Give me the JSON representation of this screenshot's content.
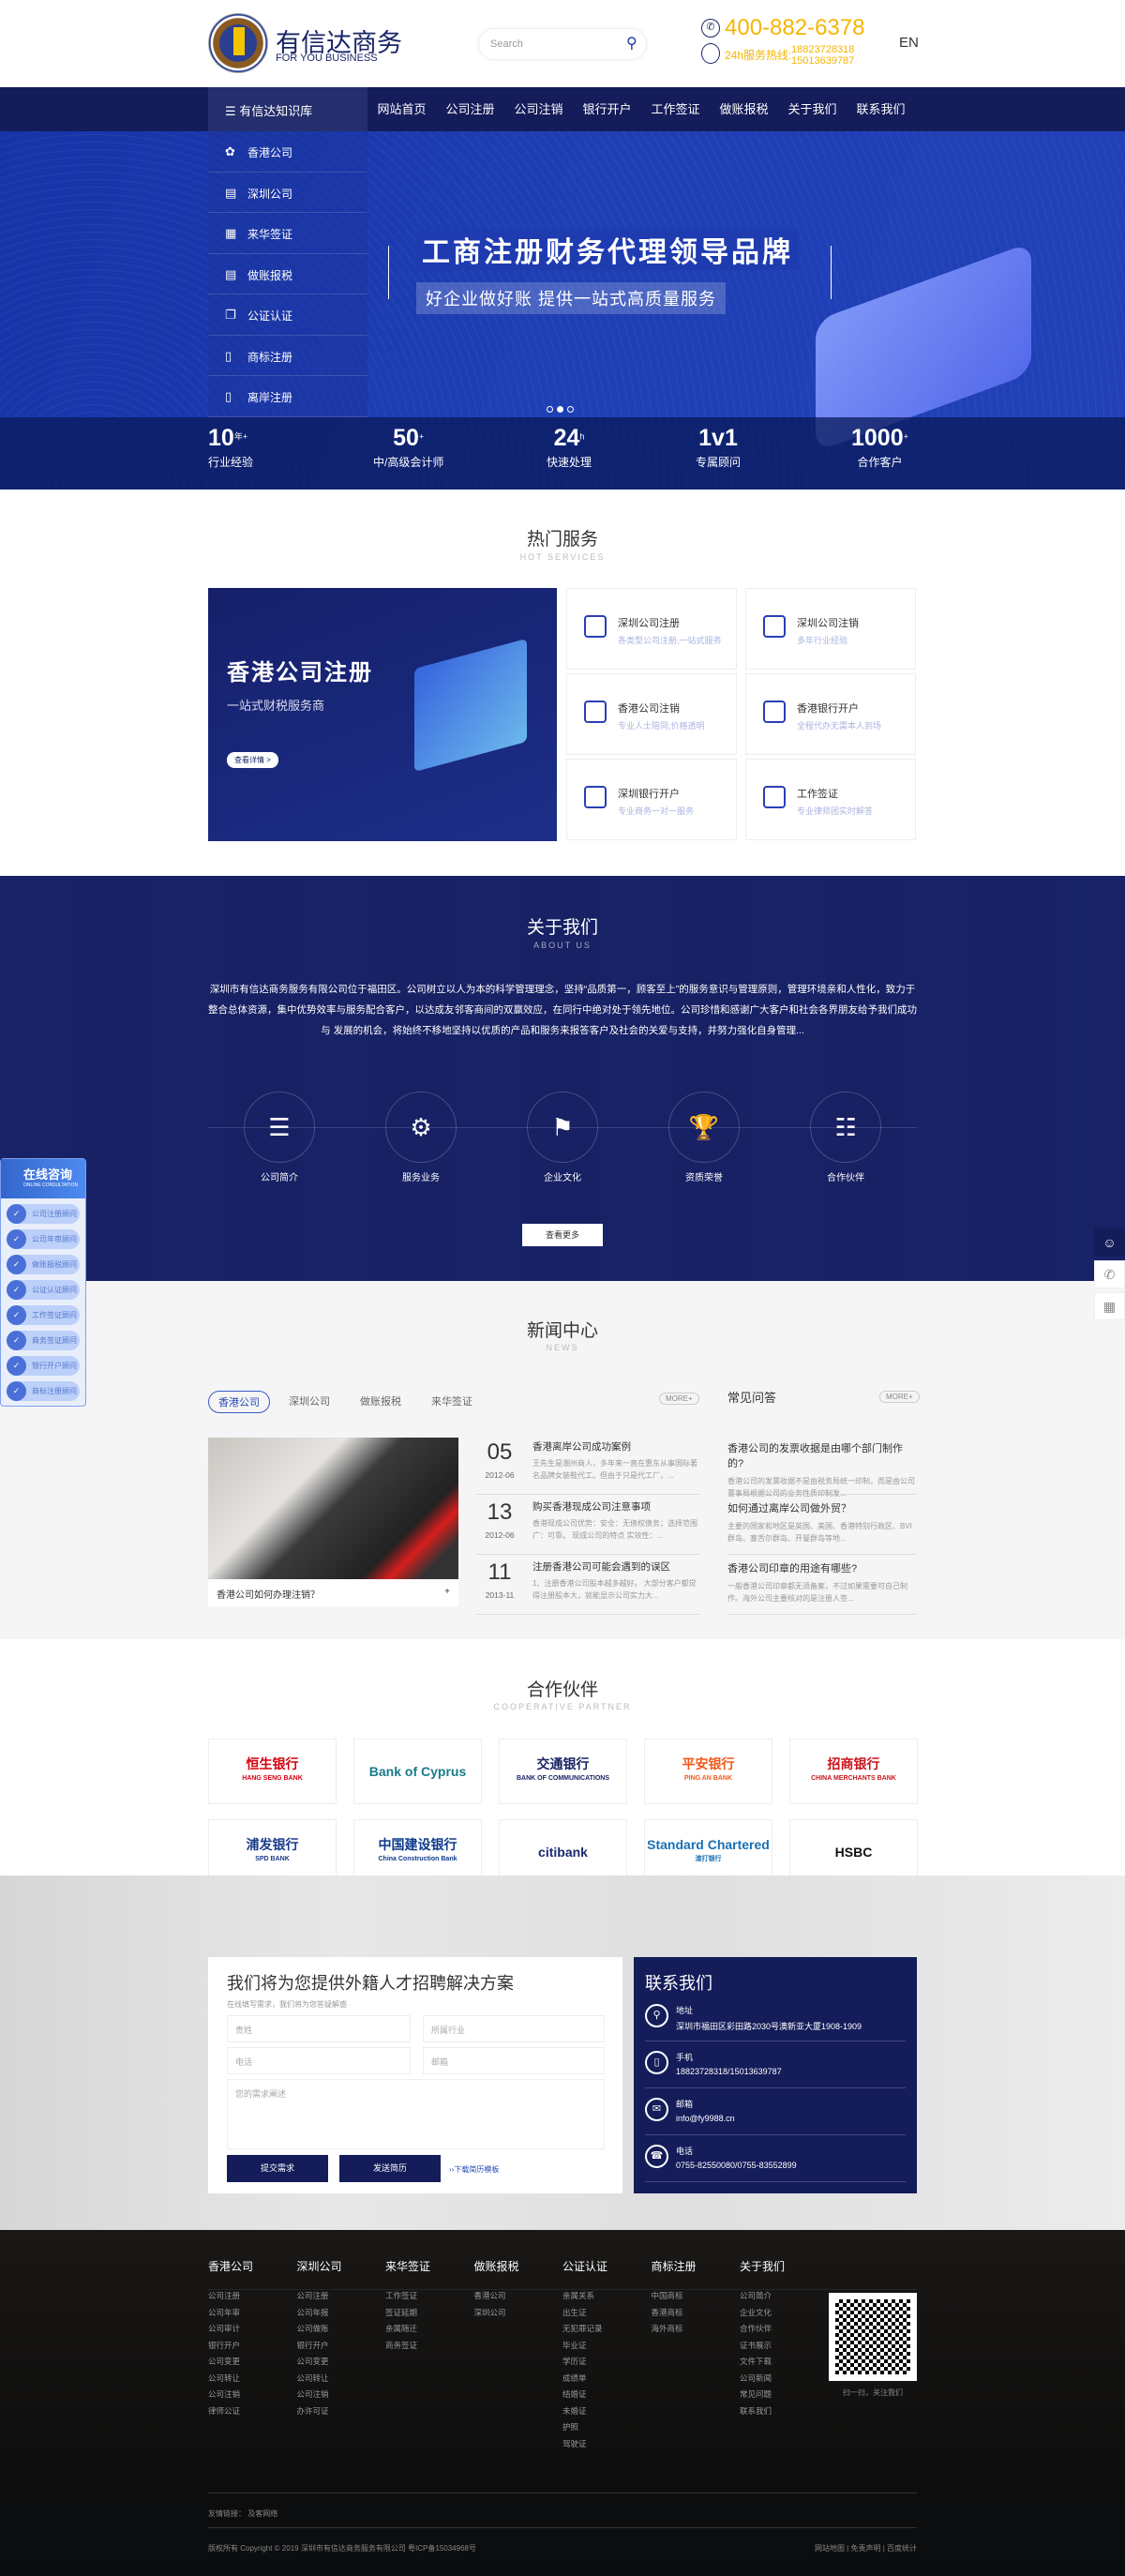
{
  "header": {
    "brand": "有信达商务",
    "brand_en": "FOR YOU BUSINESS",
    "search_placeholder": "Search",
    "phone": "400-882-6378",
    "hotline_label": "24h服务热线:",
    "hotline_1": "18823728318",
    "hotline_2": "15013639787",
    "lang": "EN"
  },
  "nav": {
    "kb": "有信达知识库",
    "items": [
      "网站首页",
      "公司注册",
      "公司注销",
      "银行开户",
      "工作签证",
      "做账报税",
      "关于我们",
      "联系我们"
    ]
  },
  "side_menu": [
    {
      "label": "香港公司",
      "icon": "bauhinia-icon"
    },
    {
      "label": "深圳公司",
      "icon": "bar-chart-icon"
    },
    {
      "label": "来华签证",
      "icon": "calendar-icon"
    },
    {
      "label": "做账报税",
      "icon": "document-icon"
    },
    {
      "label": "公证认证",
      "icon": "copy-icon"
    },
    {
      "label": "商标注册",
      "icon": "book-icon"
    },
    {
      "label": "离岸注册",
      "icon": "book-icon"
    }
  ],
  "banner": {
    "title": "工商注册财务代理领导品牌",
    "subtitle": "好企业做好账 提供一站式高质量服务",
    "slides": 3,
    "active_slide": 2
  },
  "stats": [
    {
      "num": "10",
      "sup": "年+",
      "label": "行业经验"
    },
    {
      "num": "50",
      "sup": "+",
      "label": "中/高级会计师"
    },
    {
      "num": "24",
      "sup": "h",
      "label": "快速处理"
    },
    {
      "num": "1v1",
      "sup": "",
      "label": "专属顾问"
    },
    {
      "num": "1000",
      "sup": "+",
      "label": "合作客户"
    }
  ],
  "hot": {
    "title": "热门服务",
    "subtitle": "HOT SERVICES",
    "card_title": "香港公司注册",
    "card_sub": "一站式财税服务商",
    "card_btn": "查看详情 >",
    "items": [
      {
        "t": "深圳公司注册",
        "d": "各类型公司注册,一站式服务"
      },
      {
        "t": "深圳公司注销",
        "d": "多年行业经验"
      },
      {
        "t": "香港公司注销",
        "d": "专业人士陪同,价格透明"
      },
      {
        "t": "香港银行开户",
        "d": "全程代办无需本人到场"
      },
      {
        "t": "深圳银行开户",
        "d": "专业商务一对一服务"
      },
      {
        "t": "工作签证",
        "d": "专业律师团实时解答"
      }
    ]
  },
  "about": {
    "title": "关于我们",
    "subtitle": "ABOUT US",
    "text": "深圳市有信达商务服务有限公司位于福田区。公司树立以人为本的科学管理理念，坚持“品质第一，顾客至上”的服务意识与管理原则，管理环境亲和人性化，致力于 整合总体资源，集中优势效率与服务配合客户，以达成友邻客商间的双赢效应，在同行中绝对处于领先地位。公司珍惜和感谢广大客户和社会各界朋友给予我们成功与 发展的机会，将始终不移地坚持以优质的产品和服务来报答客户及社会的关爱与支持，并努力强化自身管理...",
    "items": [
      {
        "label": "公司简介",
        "icon": "list-icon"
      },
      {
        "label": "服务业务",
        "icon": "robot-arm-icon"
      },
      {
        "label": "企业文化",
        "icon": "bookmark-icon"
      },
      {
        "label": "资质荣誉",
        "icon": "trophy-icon"
      },
      {
        "label": "合作伙伴",
        "icon": "sitemap-icon"
      }
    ],
    "more": "查看更多"
  },
  "news": {
    "title": "新闻中心",
    "subtitle": "NEWS",
    "tabs": [
      "香港公司",
      "深圳公司",
      "做账报税",
      "来华签证"
    ],
    "more": "MORE+",
    "featured": "香港公司如何办理注销？",
    "items": [
      {
        "day": "05",
        "ym": "2012-06",
        "title": "香港离岸公司成功案例",
        "desc": "王先生是潮州商人，多年来一直在惠东从事国际著名品牌女装鞋代工。但由于只是代工厂，..."
      },
      {
        "day": "13",
        "ym": "2012-06",
        "title": "购买香港现成公司注意事项",
        "desc": "香港现成公司优势：安全：无债权债务；选择范围广：可靠。 现成公司的特点 实效性：..."
      },
      {
        "day": "11",
        "ym": "2013-11",
        "title": "注册香港公司可能会遇到的误区",
        "desc": "1、注册香港公司股本越多越好。 大部分客户都觉得注册股本大，就能显示公司实力大..."
      }
    ],
    "faq_title": "常见问答",
    "faq": [
      {
        "q": "香港公司的发票收据是由哪个部门制作的?",
        "a": "香港公司的发票收据不是由税务局统一印制，而是由公司董事局根据公司的业务性质印制发..."
      },
      {
        "q": "如何通过离岸公司做外贸？",
        "a": "主要的国家和地区是英国、美国、香港特别行政区、BVI群岛、塞舌尔群岛、开曼群岛等地..."
      },
      {
        "q": "香港公司印章的用途有哪些?",
        "a": "一般香港公司印章都无须备案，不过如果需要可自己制作。海外公司主要核对的是注册人签..."
      }
    ]
  },
  "partners": {
    "title": "合作伙伴",
    "subtitle": "COOPERATIVE PARTNER",
    "logos": [
      {
        "name": "恒生银行",
        "en": "HANG SENG BANK",
        "color": "#d7000f"
      },
      {
        "name": "Bank of Cyprus",
        "en": "",
        "color": "#1a7a8a"
      },
      {
        "name": "交通银行",
        "en": "BANK OF COMMUNICATIONS",
        "color": "#1a2466"
      },
      {
        "name": "平安银行",
        "en": "PING AN BANK",
        "color": "#f05a1a"
      },
      {
        "name": "招商银行",
        "en": "CHINA MERCHANTS BANK",
        "color": "#c8161d"
      },
      {
        "name": "浦发银行",
        "en": "SPD BANK",
        "color": "#1a3a8a"
      },
      {
        "name": "中国建设银行",
        "en": "China Construction Bank",
        "color": "#0d3a8a"
      },
      {
        "name": "citibank",
        "en": "",
        "color": "#1a2a70"
      },
      {
        "name": "Standard Chartered",
        "en": "渣打银行",
        "color": "#1a70b5"
      },
      {
        "name": "HSBC",
        "en": "",
        "color": "#111"
      }
    ]
  },
  "contact_form": {
    "title": "我们将为您提供外籍人才招聘解决方案",
    "sub": "在线填写需求，我们将为您答疑解惑",
    "name": "贵姓",
    "industry": "所属行业",
    "phone": "电话",
    "email": "邮箱",
    "desc": "您的需求阐述",
    "submit": "提交需求",
    "resume": "发送简历",
    "download": "››下载简历模板"
  },
  "contact": {
    "title": "联系我们",
    "rows": [
      {
        "label": "地址",
        "value": "深圳市福田区彩田路2030号澳新亚大厦1908-1909",
        "icon": "location-icon"
      },
      {
        "label": "手机",
        "value": "18823728318/15013639787",
        "icon": "mobile-icon"
      },
      {
        "label": "邮箱",
        "value": "info@fy9988.cn",
        "icon": "mail-icon"
      },
      {
        "label": "电话",
        "value": "0755-82550080/0755-83552899",
        "icon": "telephone-icon"
      }
    ]
  },
  "footer": {
    "cols": [
      {
        "h": "香港公司",
        "items": [
          "公司注册",
          "公司年审",
          "公司审计",
          "银行开户",
          "公司变更",
          "公司转让",
          "公司注销",
          "律师公证"
        ]
      },
      {
        "h": "深圳公司",
        "items": [
          "公司注册",
          "公司年报",
          "公司做账",
          "银行开户",
          "公司变更",
          "公司转让",
          "公司注销",
          "办许可证"
        ]
      },
      {
        "h": "来华签证",
        "items": [
          "工作签证",
          "签证延期",
          "亲属随迁",
          "商务签证"
        ]
      },
      {
        "h": "做账报税",
        "items": [
          "香港公司",
          "深圳公司"
        ]
      },
      {
        "h": "公证认证",
        "items": [
          "亲属关系",
          "出生证",
          "无犯罪记录",
          "毕业证",
          "学历证",
          "成绩单",
          "结婚证",
          "未婚证",
          "护照",
          "驾驶证"
        ]
      },
      {
        "h": "商标注册",
        "items": [
          "中国商标",
          "香港商标",
          "海外商标"
        ]
      },
      {
        "h": "关于我们",
        "items": [
          "公司简介",
          "企业文化",
          "合作伙伴",
          "证书展示",
          "文件下载",
          "公司新闻",
          "常见问题",
          "联系我们"
        ]
      }
    ],
    "qr_text": "扫一扫，关注我们",
    "friend_links": "友情链接：  及客网络",
    "copyright": "版权所有 Copyright © 2019 深圳市有信达商务服务有限公司   粤ICP备15034968号",
    "links": "网站地图 | 免责声明 | 百度统计"
  },
  "float_left": {
    "title": "在线咨询",
    "title_en": "ONLINE CONSULTATION",
    "items": [
      "公司注册顾问",
      "公司年审顾问",
      "做账报税顾问",
      "公证认证顾问",
      "工作签证顾问",
      "商务签证顾问",
      "银行开户顾问",
      "商标注册顾问"
    ]
  },
  "colors": {
    "navy": "#141c5a",
    "banner": "#1e3fb4",
    "accent": "#f6b500",
    "link": "#2a4ab5"
  }
}
